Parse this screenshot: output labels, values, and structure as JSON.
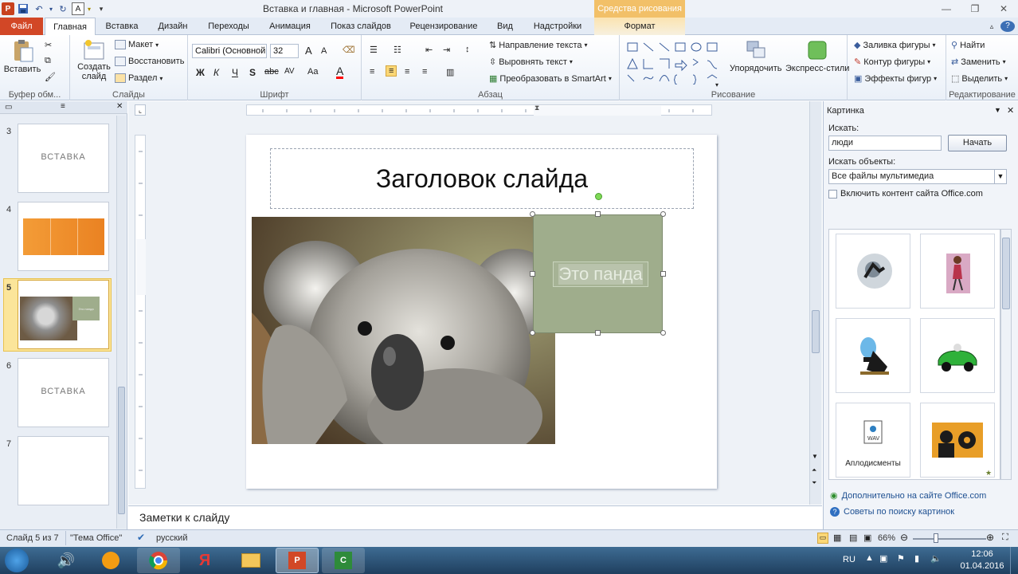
{
  "window": {
    "title": "Вставка и главная  -  Microsoft PowerPoint",
    "context_tab_header": "Средства рисования"
  },
  "qat": {
    "app_icon": "P"
  },
  "tabs": [
    "Файл",
    "Главная",
    "Вставка",
    "Дизайн",
    "Переходы",
    "Анимация",
    "Показ слайдов",
    "Рецензирование",
    "Вид",
    "Надстройки",
    "Формат"
  ],
  "ribbon": {
    "clipboard": {
      "paste": "Вставить",
      "label": "Буфер обм..."
    },
    "slides": {
      "new_slide": "Создать",
      "new_slide2": "слайд",
      "layout": "Макет",
      "reset": "Восстановить",
      "section": "Раздел",
      "label": "Слайды"
    },
    "font": {
      "name": "Calibri (Основной",
      "size": "32",
      "label": "Шрифт",
      "bold": "Ж",
      "italic": "К",
      "underline": "Ч",
      "shadow": "S",
      "strike": "abc",
      "spacing": "AV",
      "case": "Aa",
      "grow": "A",
      "shrink": "A",
      "color_letter": "A"
    },
    "paragraph": {
      "text_direction": "Направление текста",
      "align_text": "Выровнять текст",
      "smartart": "Преобразовать в SmartArt",
      "label": "Абзац"
    },
    "drawing": {
      "arrange": "Упорядочить",
      "styles": "Экспресс-стили",
      "fill": "Заливка фигуры",
      "outline": "Контур фигуры",
      "effects": "Эффекты фигур",
      "label": "Рисование"
    },
    "editing": {
      "find": "Найти",
      "replace": "Заменить",
      "select": "Выделить",
      "label": "Редактирование"
    }
  },
  "slides_panel": {
    "numbers": [
      "3",
      "4",
      "5",
      "6",
      "7"
    ],
    "thumb3_title": "ВСТАВКА",
    "thumb6_title": "ВСТАВКА",
    "thumb5_caption": "Это панда"
  },
  "slide": {
    "title": "Заголовок слайда",
    "shape_text": "Это панда"
  },
  "notes": {
    "placeholder": "Заметки к слайду"
  },
  "clipart": {
    "pane_title": "Картинка",
    "search_label": "Искать:",
    "search_value": "люди",
    "go_button": "Начать",
    "results_label": "Искать объекты:",
    "results_value": "Все файлы мультимедиа",
    "include_office": "Включить контент сайта Office.com",
    "applause_caption": "Аплодисменты",
    "more_link": "Дополнительно на сайте Office.com",
    "tips_link": "Советы по поиску картинок"
  },
  "status": {
    "slide_info": "Слайд 5 из 7",
    "theme": "\"Тема Office\"",
    "language": "русский",
    "zoom": "66%"
  },
  "taskbar": {
    "lang": "RU",
    "time": "12:06",
    "date": "01.04.2016",
    "yandex": "Я"
  },
  "colors": {
    "accent": "#d24726",
    "slide_shape": "#9fad8c",
    "selected_thumb": "#f8d772",
    "orange": "#f08a2c"
  }
}
